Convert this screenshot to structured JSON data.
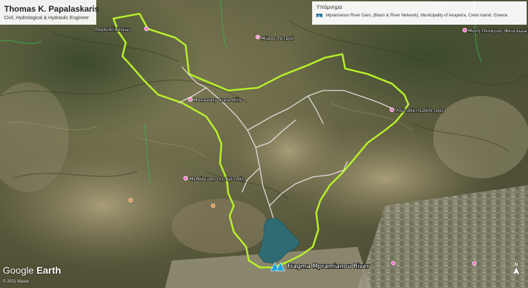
{
  "header": {
    "title": "Thomas K. Papalaskaris",
    "subtitle": "Civil, Hydrological & Hydraulic Engineer"
  },
  "legend": {
    "title": "Υπόμνημα",
    "item_label": "Mpramianos River Dam, (Basin & River Network), Municipality of Ierapetra, Crete Island, Greece",
    "item_icon": "map-layer-icon"
  },
  "map": {
    "dam_label": "Fragma Mpramianou River",
    "place_labels": [
      "Λαγουλί Χανίων",
      "Μύρος Πετριά",
      "Μονή Πανάγιας Φανερωμένης",
      "Monastery Crete Hills",
      "Λουτράκι Ιεράπετρας",
      "Μεθόδευση της Κριτσάς"
    ],
    "colors": {
      "basin_outline": "#b7f02b",
      "river_network": "#e8e8e8",
      "reservoir": "#2f6b72",
      "terrain_base": "#5b5a3f"
    }
  },
  "branding": {
    "logo_word_1": "Google",
    "logo_word_2": "Earth",
    "copyright": "© 2021 Maxar"
  }
}
